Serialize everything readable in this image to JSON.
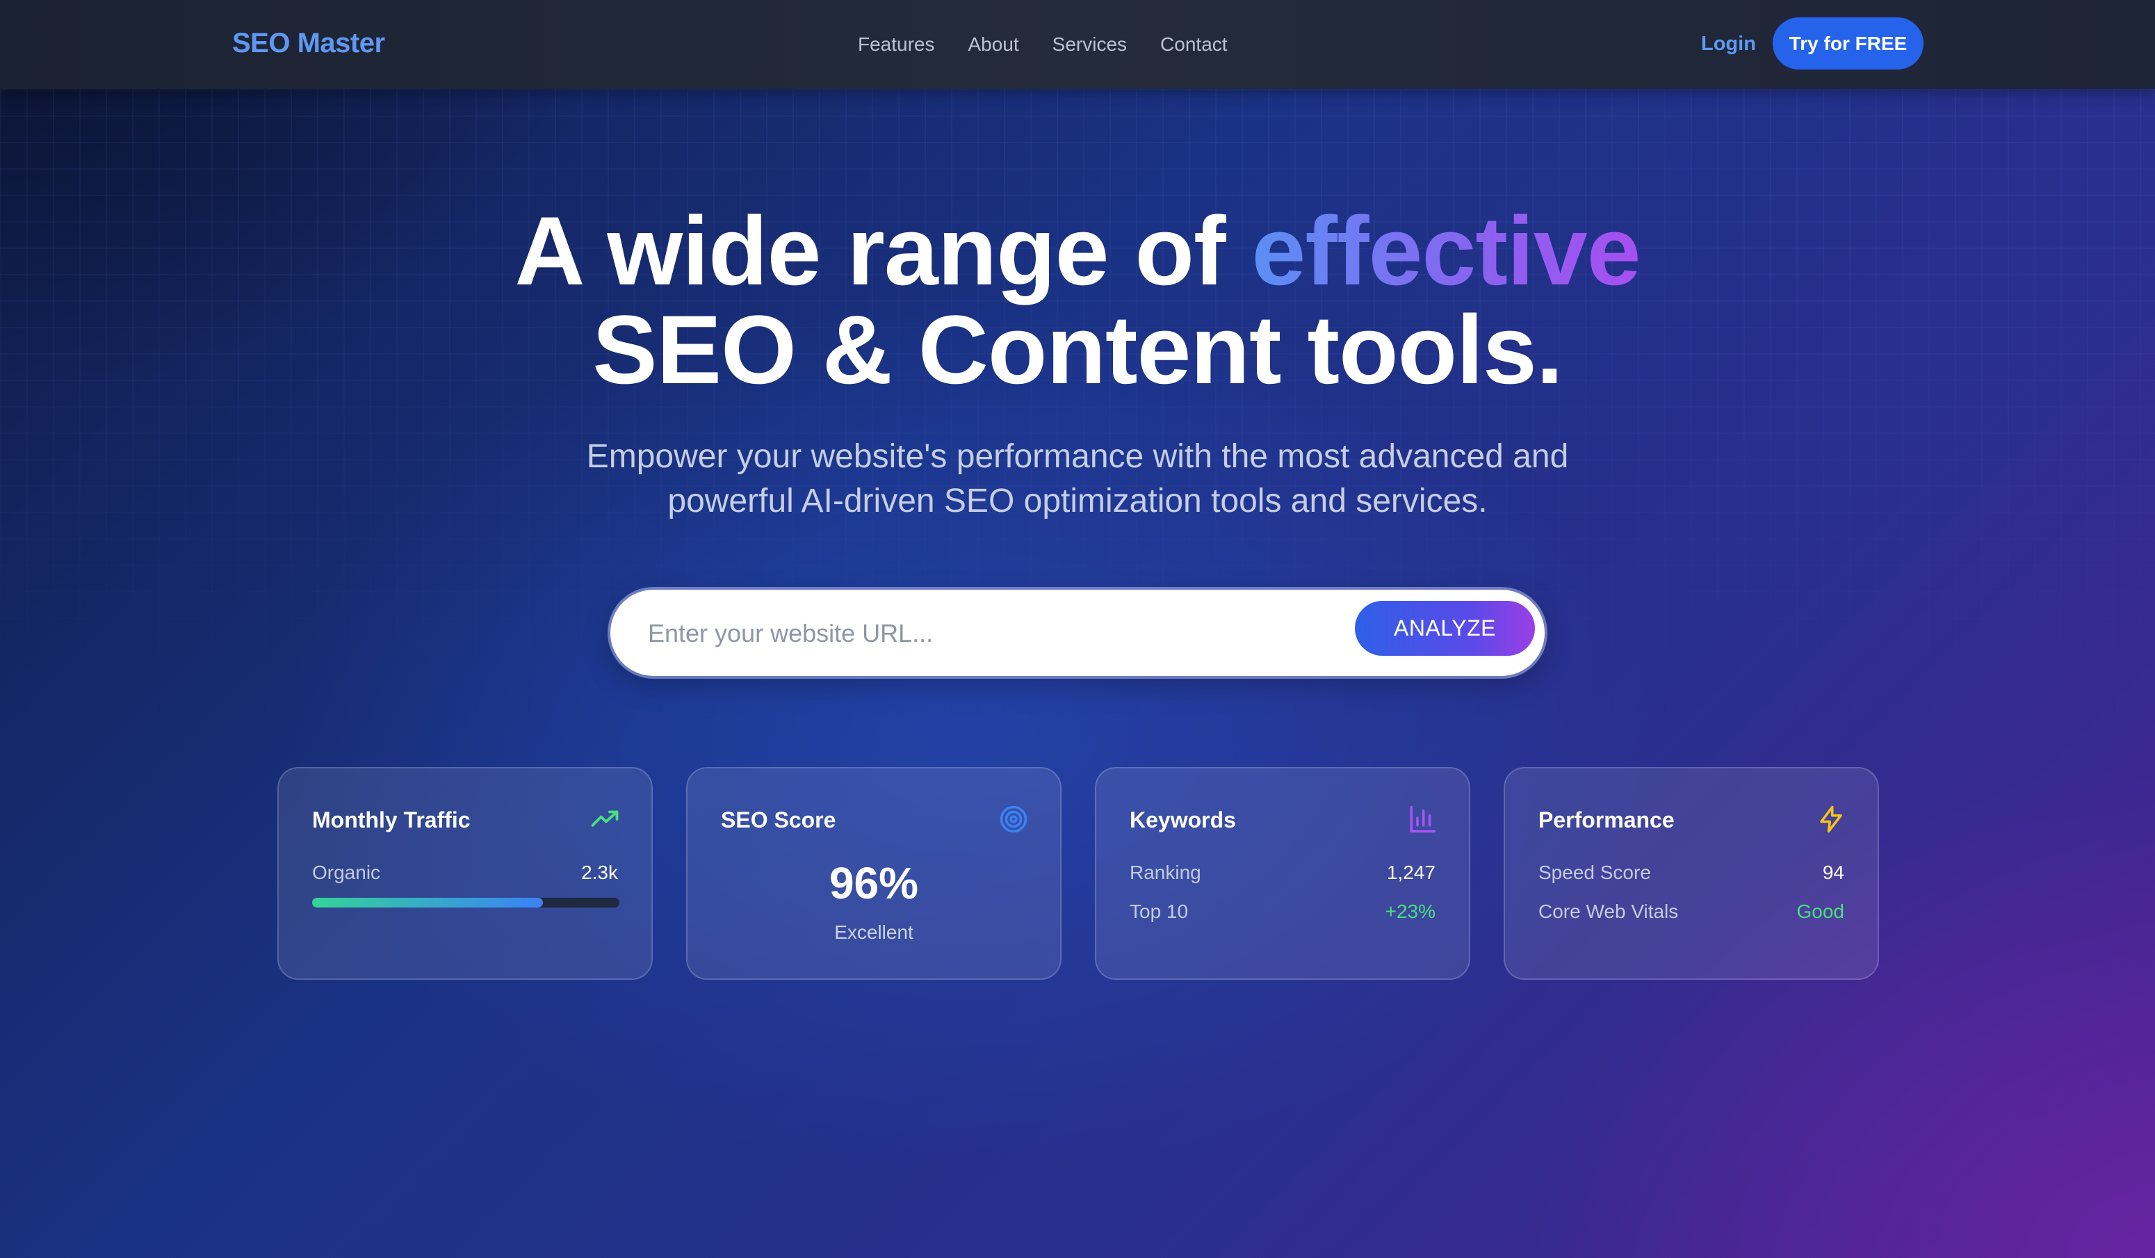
{
  "nav": {
    "brand": "SEO Master",
    "links": [
      "Features",
      "About",
      "Services",
      "Contact"
    ],
    "login": "Login",
    "cta": "Try for FREE"
  },
  "hero": {
    "title_line1_start": "A wide range of ",
    "title_line1_accent": "effective",
    "title_line2": "SEO & Content tools.",
    "subtitle_line1": "Empower your website's performance with the most advanced and",
    "subtitle_line2": "powerful AI-driven SEO optimization tools and services."
  },
  "search": {
    "placeholder": "Enter your website URL...",
    "value": "",
    "button": "ANALYZE"
  },
  "cards": {
    "traffic": {
      "title": "Monthly Traffic",
      "icon": "trending-up-icon",
      "label": "Organic",
      "value": "2.3k",
      "progress_fraction": 0.75
    },
    "seo_score": {
      "title": "SEO Score",
      "icon": "target-icon",
      "score": "96%",
      "label": "Excellent"
    },
    "keywords": {
      "title": "Keywords",
      "icon": "bar-chart-icon",
      "rows": [
        {
          "label": "Ranking",
          "value": "1,247"
        },
        {
          "label": "Top 10",
          "value": "+23%"
        }
      ]
    },
    "performance": {
      "title": "Performance",
      "icon": "lightning-icon",
      "rows": [
        {
          "label": "Speed Score",
          "value": "94"
        },
        {
          "label": "Core Web Vitals",
          "value": "Good"
        }
      ]
    }
  },
  "colors": {
    "brand": "#5f98f3",
    "cta": "#2563eb",
    "accent_green": "#4ade80",
    "accent_purple": "#a855f7",
    "accent_yellow": "#f5c518"
  }
}
